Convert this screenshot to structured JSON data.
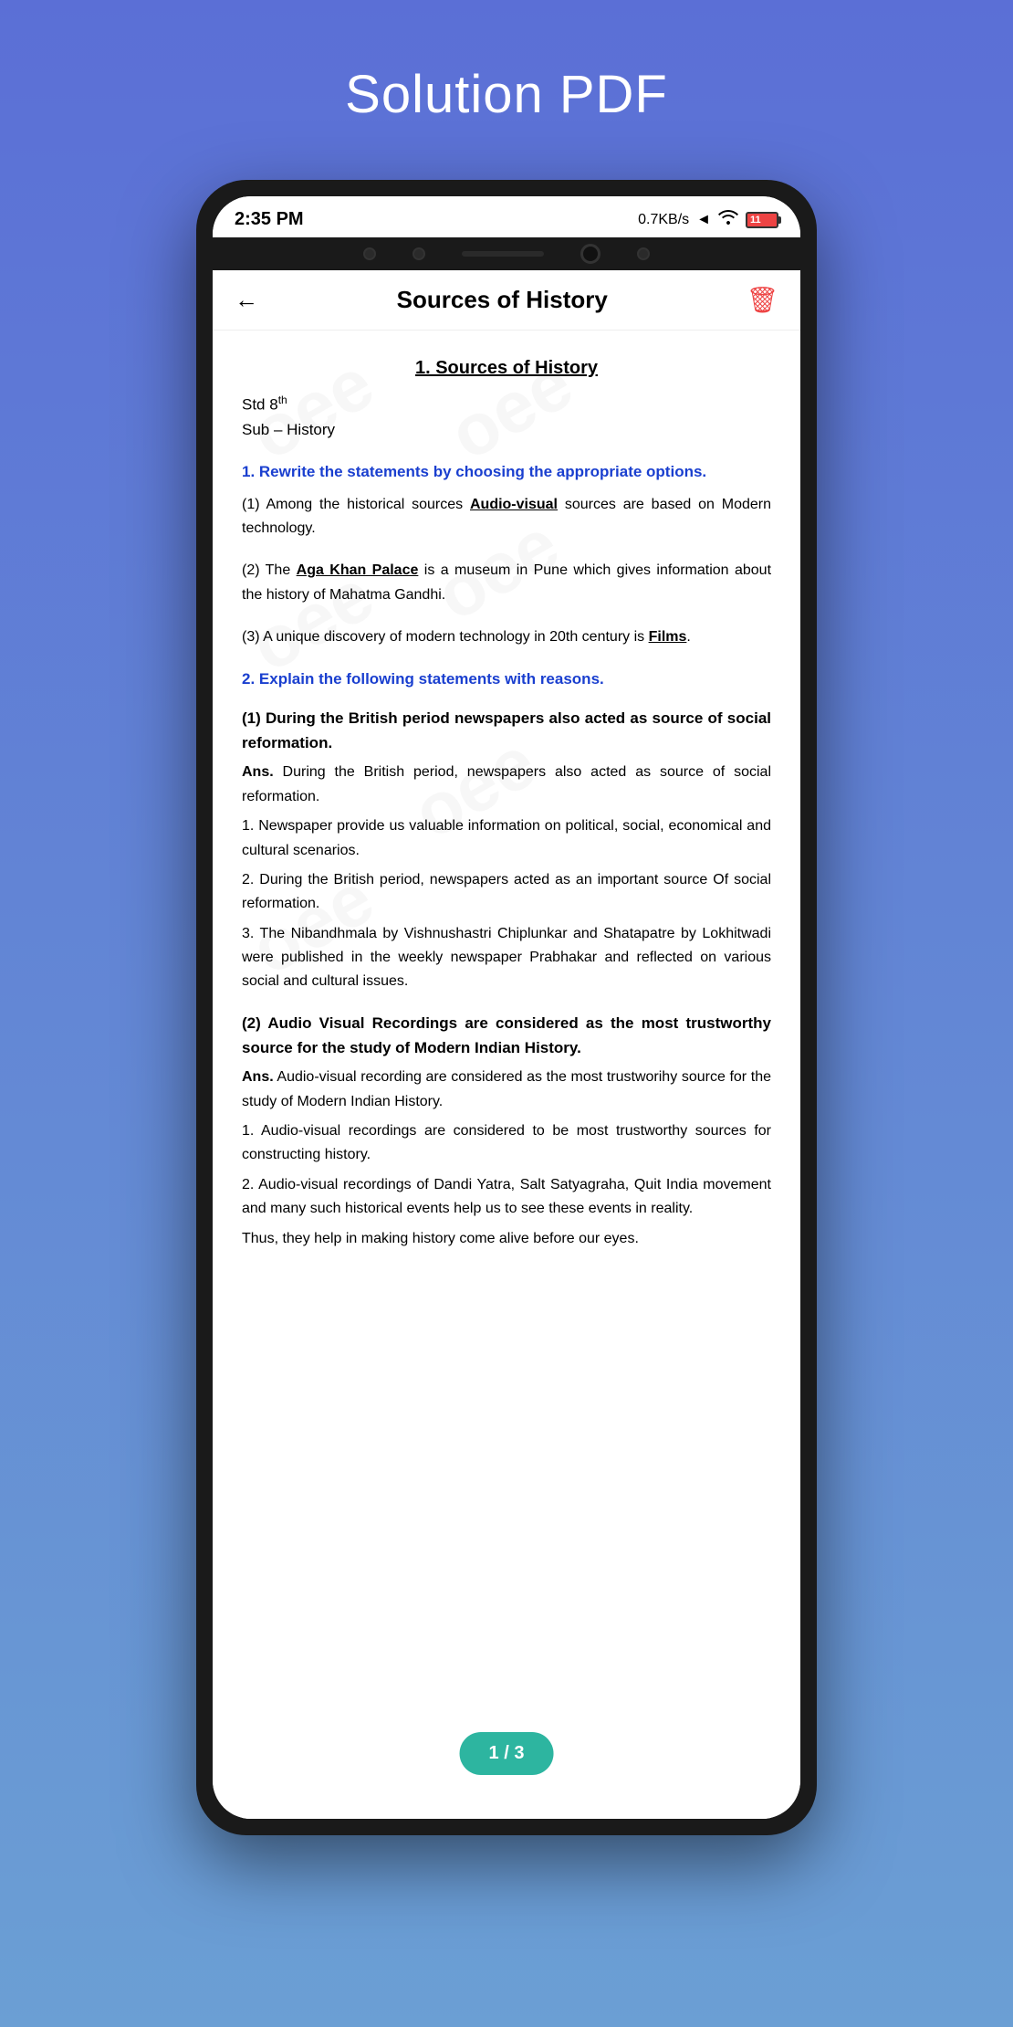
{
  "header": {
    "title": "Solution PDF"
  },
  "status_bar": {
    "time": "2:35 PM",
    "network": "0.7KB/s",
    "wifi": "wifi",
    "battery": "11"
  },
  "app_bar": {
    "title": "Sources of History",
    "back_label": "←",
    "delete_label": "🗑"
  },
  "document": {
    "title": "1. Sources of History",
    "std": "Std 8",
    "std_superscript": "th",
    "sub": "Sub – History",
    "q1_heading": "1.  Rewrite the statements by choosing the appropriate options.",
    "q1_a1": "(1) Among the historical sources Audio-visual sources are based on Modern technology.",
    "q1_a2": "(2) The Aga Khan Palace is a museum in Pune which gives information about the history of Mahatma Gandhi.",
    "q1_a3": "(3) A unique discovery of modern technology in 20th century is Films.",
    "q2_heading": "2. Explain the following statements with reasons.",
    "q2_sub1": "(1) During the British period newspapers also acted as source of social reformation.",
    "q2_ans_intro": "Ans. During the British period, newspapers also acted as source of social reformation.",
    "q2_point1": "1.  Newspaper provide us valuable information on political, social, economical and cultural scenarios.",
    "q2_point2": "2.  During the British period, newspapers acted as an important source Of social reformation.",
    "q2_point3": "3.  The Nibandhmala by Vishnushastri Chiplunkar and Shatapatre by Lokhitwadi were published in the weekly newspaper Prabhakar and reflected on various social and cultural issues.",
    "q2_sub2": "(2) Audio Visual Recordings are considered as the most trustworthy source for the study of Modern Indian History.",
    "q2_ans2_intro": "Ans.  Audio-visual recording are considered as the most trustworihy source for the study of Modern Indian History.",
    "q2_ans2_p1": "1.  Audio-visual recordings are considered to be most trustworthy sources for constructing history.",
    "q2_ans2_p2": "2.  Audio-visual recordings of Dandi Yatra, Salt Satyagraha, Quit India movement and many such historical events help us to see these events in reality.",
    "q2_ans2_p3": "Thus, they help in making history come alive before our eyes."
  },
  "page_indicator": {
    "label": "1 / 3"
  },
  "watermark_texts": [
    "oee",
    "oee",
    "oee",
    "oee",
    "oee",
    "oee"
  ]
}
